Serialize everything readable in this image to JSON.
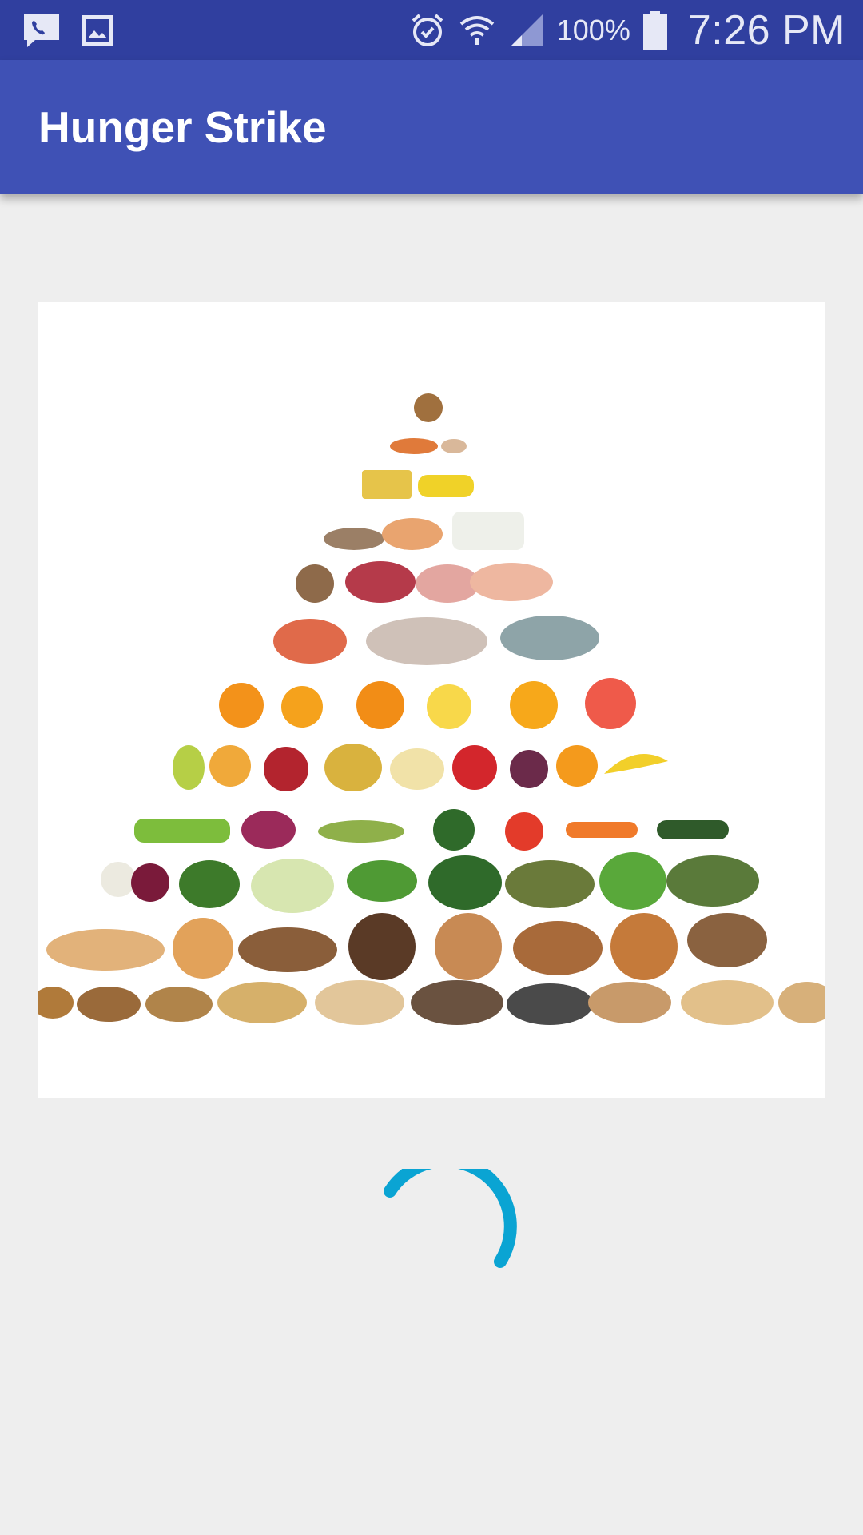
{
  "status_bar": {
    "battery_percent": "100%",
    "time": "7:26 PM",
    "icons_left": [
      "voicemail-icon",
      "image-icon"
    ],
    "icons_right": [
      "alarm-icon",
      "wifi-icon",
      "signal-icon",
      "battery-icon"
    ]
  },
  "app_bar": {
    "title": "Hunger Strike",
    "color": "#3f51b5"
  },
  "main": {
    "image": "food-pyramid-image",
    "loading_indicator": "progress-spinner",
    "accent_color": "#0aa4d3"
  }
}
